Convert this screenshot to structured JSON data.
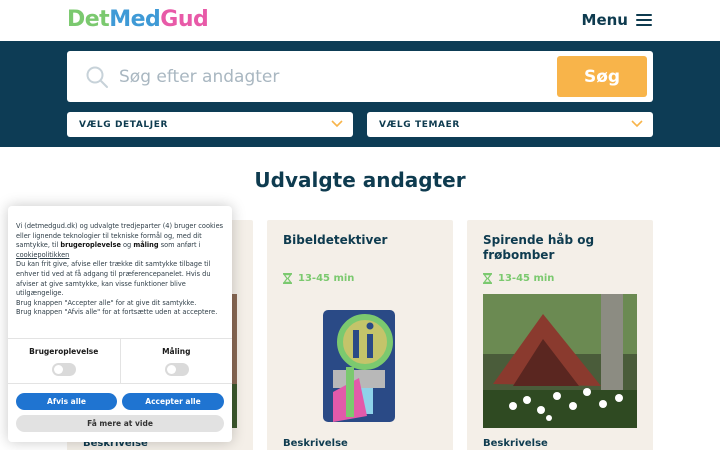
{
  "header": {
    "logo_part1": "Det",
    "logo_part2": "Med",
    "logo_part3": "Gud",
    "menu_label": "Menu"
  },
  "search": {
    "placeholder": "Søg efter andagter",
    "button_label": "Søg",
    "select_details": "VÆLG DETALJER",
    "select_themes": "VÆLG TEMAER"
  },
  "section": {
    "title": "Udvalgte andagter"
  },
  "cards": [
    {
      "title": "",
      "time": "",
      "description": "Beskrivelse"
    },
    {
      "title": "Bibeldetektiver",
      "time": "13-45 min",
      "description": "Beskrivelse"
    },
    {
      "title": "Spirende håb og frøbomber",
      "time": "13-45 min",
      "description": "Beskrivelse"
    }
  ],
  "cookie": {
    "text_a": "Vi (detmedgud.dk) og udvalgte tredjeparter (4) bruger cookies eller lignende teknologier til tekniske formål og, med dit samtykke, til ",
    "text_b_bold1": "brugeroplevelse",
    "text_c": " og ",
    "text_d_bold2": "måling",
    "text_e": " som anført i ",
    "text_f_link": "cookiepolitikken",
    "text_g": "Du kan frit give, afvise eller trække dit samtykke tilbage til enhver tid ved at få adgang til præferencepanelet. Hvis du afviser at give samtykke, kan visse funktioner blive utilgængelige.",
    "text_h": "Brug knappen \"Accepter alle\" for at give dit samtykke.",
    "text_i": "Brug knappen \"Afvis alle\" for at fortsætte uden at acceptere.",
    "toggle_1": "Brugeroplevelse",
    "toggle_2": "Måling",
    "reject_label": "Afvis alle",
    "accept_label": "Accepter alle",
    "more_label": "Få mere at vide"
  },
  "colors": {
    "navy": "#0d3c55",
    "accent_orange": "#f8b44a",
    "green": "#7bc96f",
    "blue_button": "#1f74d1"
  }
}
